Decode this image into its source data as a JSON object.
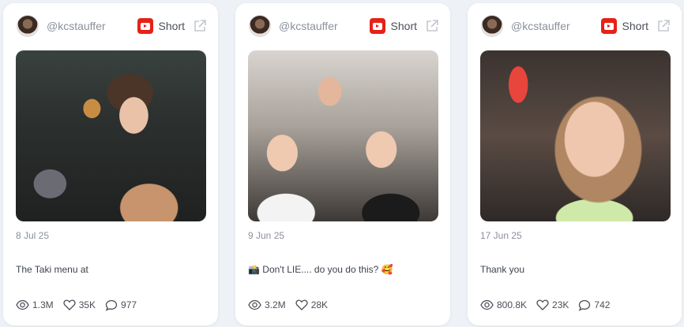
{
  "colors": {
    "background": "#eef1f5",
    "card": "#ffffff",
    "youtube_red": "#e62117",
    "muted_text": "#8a909b"
  },
  "cards": [
    {
      "handle": "@kcstauffer",
      "platform_icon": "youtube-icon",
      "type": "Short",
      "date": "8 Jul 25",
      "caption": "The Taki menu at",
      "views": "1.3M",
      "likes": "35K",
      "comments": "977"
    },
    {
      "handle": "@kcstauffer",
      "platform_icon": "youtube-icon",
      "type": "Short",
      "date": "9 Jun 25",
      "caption": "📸 Don't LIE.... do you do this? 🥰",
      "views": "3.2M",
      "likes": "28K"
    },
    {
      "handle": "@kcstauffer",
      "platform_icon": "youtube-icon",
      "type": "Short",
      "date": "17 Jun 25",
      "caption": "Thank you",
      "views": "800.8K",
      "likes": "23K",
      "comments": "742"
    }
  ]
}
